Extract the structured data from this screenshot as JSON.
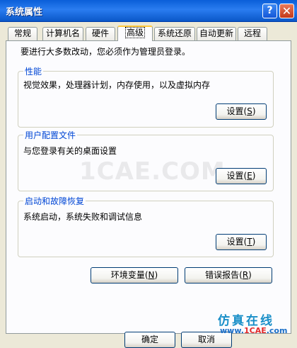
{
  "window": {
    "title": "系统属性",
    "help": "?",
    "close": "✕"
  },
  "tabs": [
    {
      "label": "常规"
    },
    {
      "label": "计算机名"
    },
    {
      "label": "硬件"
    },
    {
      "label": "高级"
    },
    {
      "label": "系统还原"
    },
    {
      "label": "自动更新"
    },
    {
      "label": "远程"
    }
  ],
  "intro": "要进行大多数改动，您必须作为管理员登录。",
  "performance": {
    "title": "性能",
    "desc": "视觉效果，处理器计划，内存使用，以及虚拟内存",
    "button": {
      "text": "设置",
      "key": "S"
    }
  },
  "profiles": {
    "title": "用户配置文件",
    "desc": "与您登录有关的桌面设置",
    "button": {
      "text": "设置",
      "key": "E"
    }
  },
  "startup": {
    "title": "启动和故障恢复",
    "desc": "系统启动，系统失败和调试信息",
    "button": {
      "text": "设置",
      "key": "T"
    }
  },
  "env_button": {
    "text": "环境变量",
    "key": "N"
  },
  "error_button": {
    "text": "错误报告",
    "key": "R"
  },
  "footer": {
    "ok": "确定",
    "cancel": "取消"
  },
  "watermarks": {
    "center": "1CAE.COM",
    "corner": "仿真在线",
    "url_prefix": "www.",
    "url_brand": "1CAE",
    ".com": ".com"
  }
}
